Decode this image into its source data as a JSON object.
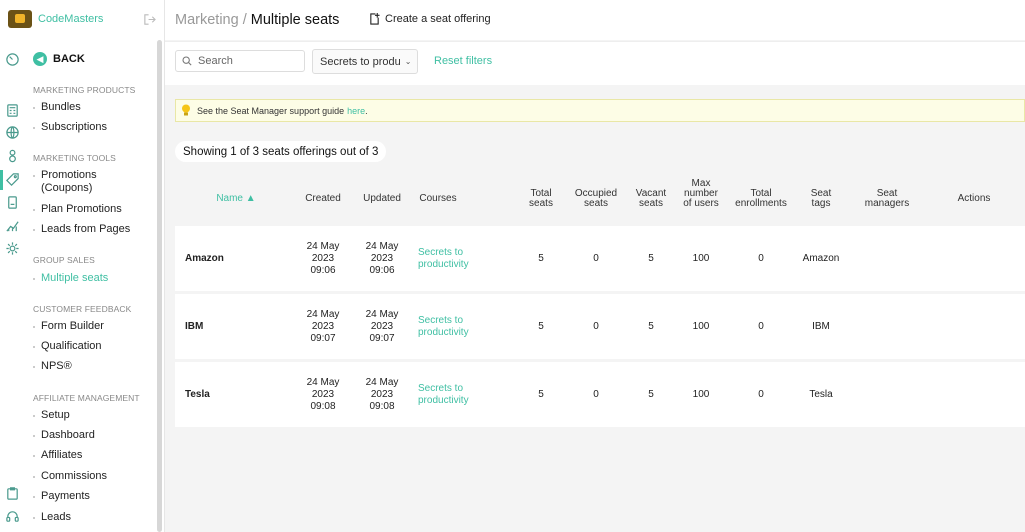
{
  "brand": {
    "name": "CodeMasters"
  },
  "sidebar": {
    "back_label": "BACK",
    "sections": [
      {
        "title": "MARKETING PRODUCTS",
        "items": [
          "Bundles",
          "Subscriptions"
        ]
      },
      {
        "title": "MARKETING TOOLS",
        "items": [
          "Promotions (Coupons)",
          "Plan Promotions",
          "Leads from Pages"
        ]
      },
      {
        "title": "GROUP SALES",
        "items": [
          "Multiple seats"
        ]
      },
      {
        "title": "CUSTOMER FEEDBACK",
        "items": [
          "Form Builder",
          "Qualification",
          "NPS®"
        ]
      },
      {
        "title": "AFFILIATE MANAGEMENT",
        "items": [
          "Setup",
          "Dashboard",
          "Affiliates",
          "Commissions",
          "Payments",
          "Leads"
        ]
      }
    ],
    "active_item": "Multiple seats"
  },
  "header": {
    "breadcrumb_parent": "Marketing /",
    "breadcrumb_current": "Multiple seats",
    "create_label": "Create a seat offering"
  },
  "filters": {
    "search_placeholder": "Search",
    "course_select": "Secrets to produ",
    "reset_label": "Reset filters"
  },
  "banner": {
    "text": "See the Seat Manager support guide",
    "link": "here",
    "suffix": "."
  },
  "summary": "Showing 1 of 3 seats offerings out of 3",
  "table": {
    "columns": {
      "name": "Name ▲",
      "created": "Created",
      "updated": "Updated",
      "courses": "Courses",
      "total_seats": "Total seats",
      "occupied_seats": "Occupied seats",
      "vacant_seats": "Vacant seats",
      "max_users": "Max number of users",
      "total_enrollments": "Total enrollments",
      "seat_tags": "Seat tags",
      "seat_managers": "Seat managers",
      "actions": "Actions"
    },
    "rows": [
      {
        "name": "Amazon",
        "created": [
          "24 May",
          "2023",
          "09:06"
        ],
        "updated": [
          "24 May",
          "2023",
          "09:06"
        ],
        "course": [
          "Secrets to",
          "productivity"
        ],
        "total_seats": "5",
        "occupied_seats": "0",
        "vacant_seats": "5",
        "max_users": "100",
        "total_enrollments": "0",
        "seat_tags": "Amazon"
      },
      {
        "name": "IBM",
        "created": [
          "24 May",
          "2023",
          "09:07"
        ],
        "updated": [
          "24 May",
          "2023",
          "09:07"
        ],
        "course": [
          "Secrets to",
          "productivity"
        ],
        "total_seats": "5",
        "occupied_seats": "0",
        "vacant_seats": "5",
        "max_users": "100",
        "total_enrollments": "0",
        "seat_tags": "IBM"
      },
      {
        "name": "Tesla",
        "created": [
          "24 May",
          "2023",
          "09:08"
        ],
        "updated": [
          "24 May",
          "2023",
          "09:08"
        ],
        "course": [
          "Secrets to",
          "productivity"
        ],
        "total_seats": "5",
        "occupied_seats": "0",
        "vacant_seats": "5",
        "max_users": "100",
        "total_enrollments": "0",
        "seat_tags": "Tesla"
      }
    ]
  },
  "colors": {
    "accent": "#3fbfa3",
    "banner_bg": "#fdfde6"
  }
}
